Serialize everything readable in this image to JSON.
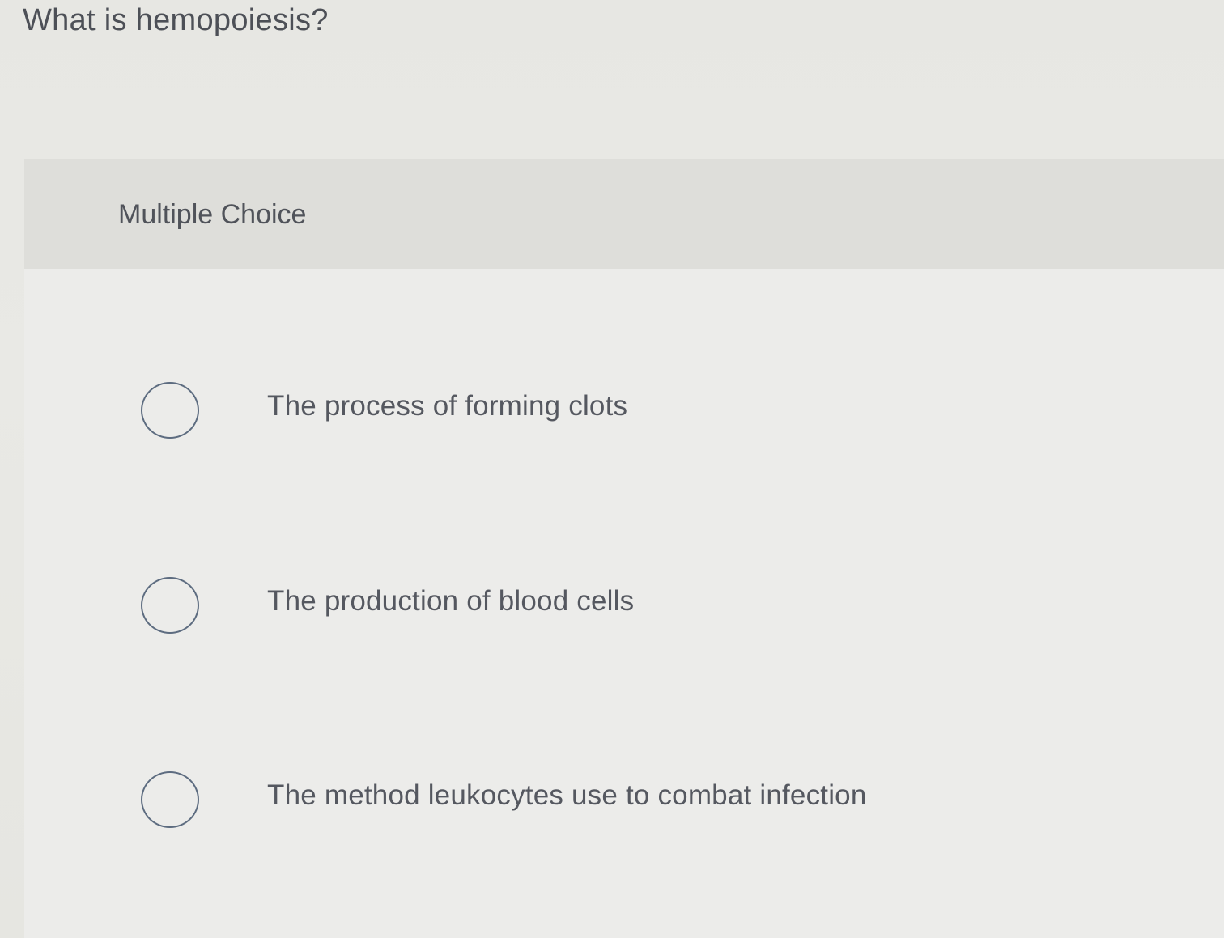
{
  "question": {
    "text": "What is hemopoiesis?"
  },
  "card": {
    "type_label": "Multiple Choice"
  },
  "choices": [
    {
      "label": "The process of forming clots",
      "selected": false
    },
    {
      "label": "The production of blood cells",
      "selected": false
    },
    {
      "label": "The method leukocytes use to combat infection",
      "selected": false
    }
  ],
  "colors": {
    "page_background": "#e8e8e4",
    "header_band": "#dededa",
    "radio_border": "#5d6c80",
    "text": "#555860"
  }
}
